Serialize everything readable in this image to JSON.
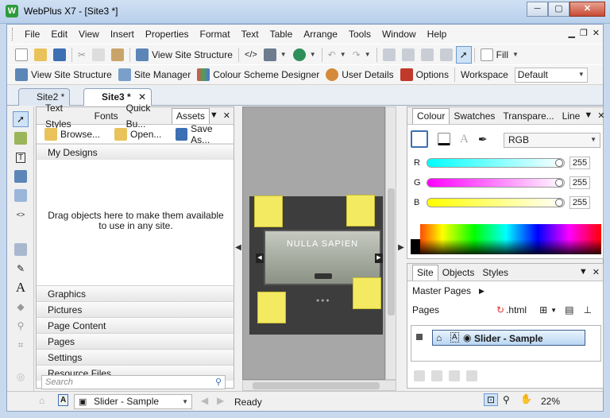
{
  "window": {
    "title": "WebPlus X7 - [Site3 *]",
    "logo": "W",
    "controls": [
      "─",
      "▢",
      "✕"
    ]
  },
  "menu": {
    "items": [
      "File",
      "Edit",
      "View",
      "Insert",
      "Properties",
      "Format",
      "Text",
      "Table",
      "Arrange",
      "Tools",
      "Window",
      "Help"
    ]
  },
  "toolbar1": {
    "view_site_structure": "View Site Structure",
    "fill_label": "Fill"
  },
  "toolbar2": {
    "view_site_structure": "View Site Structure",
    "site_manager": "Site Manager",
    "colour_scheme_designer": "Colour Scheme Designer",
    "user_details": "User Details",
    "options": "Options",
    "workspace_label": "Workspace",
    "workspace_value": "Default"
  },
  "doc_tabs": [
    {
      "label": "Site2 *",
      "active": false
    },
    {
      "label": "Site3 *",
      "active": true
    }
  ],
  "assets_panel": {
    "tabs": [
      "Text Styles",
      "Fonts",
      "Quick Bu...",
      "Assets"
    ],
    "active_tab": "Assets",
    "browse": "Browse...",
    "open": "Open...",
    "save_as": "Save As...",
    "my_designs": "My Designs",
    "drag_message": "Drag objects here to make them available to use in any site.",
    "sections": [
      "Graphics",
      "Pictures",
      "Page Content",
      "Pages",
      "Settings",
      "Resource Files"
    ],
    "search_placeholder": "Search"
  },
  "canvas": {
    "slider_caption": "NULLA SAPIEN"
  },
  "colour_panel": {
    "tabs": [
      "Colour",
      "Swatches",
      "Transpare...",
      "Line"
    ],
    "active_tab": "Colour",
    "model": "RGB",
    "r_label": "R",
    "g_label": "G",
    "b_label": "B",
    "r_value": "255",
    "g_value": "255",
    "b_value": "255",
    "r_color": "#00ffff",
    "g_color": "#ff00ff",
    "b_color": "#ffff00"
  },
  "site_panel": {
    "tabs": [
      "Site",
      "Objects",
      "Styles"
    ],
    "active_tab": "Site",
    "master_pages": "Master Pages",
    "pages": "Pages",
    "html_ext": ".html",
    "page_node": "Slider - Sample"
  },
  "status": {
    "page_select": "Slider - Sample",
    "text": "Ready",
    "zoom": "22%"
  },
  "colors": {
    "accent": "#3c5f8f",
    "note_yellow": "#f3ea62",
    "close_red": "#c74a35"
  }
}
